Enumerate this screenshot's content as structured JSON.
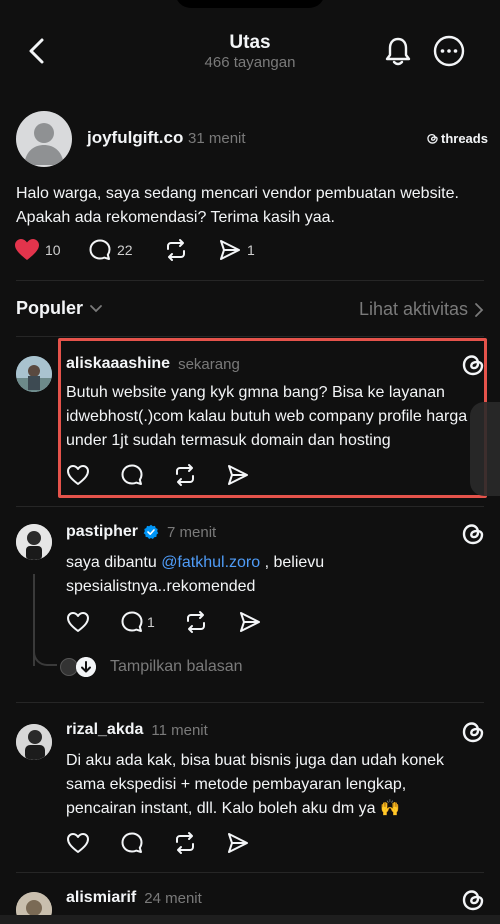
{
  "header": {
    "title": "Utas",
    "views": "466 tayangan"
  },
  "post": {
    "username": "joyfulgift.co",
    "time": "31 menit",
    "brand": "threads",
    "text": "Halo warga, saya sedang mencari vendor pembuatan website. Apakah ada rekomendasi? Terima kasih yaa.",
    "likes": "10",
    "comments": "22",
    "shares": "1",
    "like_color": "#e3344c"
  },
  "sort": {
    "label": "Populer",
    "activity": "Lihat aktivitas"
  },
  "replies": [
    {
      "username": "aliskaaashine",
      "time": "sekarang",
      "text": "Butuh website yang kyk gmna bang? Bisa ke layanan idwebhost(.)com kalau butuh web company profile harga under 1jt sudah termasuk domain dan hosting"
    },
    {
      "username": "pastipher",
      "time": "7 menit",
      "text_prefix": "saya dibantu ",
      "mention": "@fatkhul.zoro",
      "text_suffix": " , believu spesialistnya..rekomended",
      "comments": "1",
      "show_replies": "Tampilkan balasan"
    },
    {
      "username": "rizal_akda",
      "time": "11 menit",
      "text": "Di aku ada kak, bisa buat bisnis juga dan udah konek sama ekspedisi + metode pembayaran lengkap, pencairan instant, dll. Kalo boleh aku dm ya 🙌"
    },
    {
      "username": "alismiarif",
      "time": "24 menit"
    }
  ],
  "colors": {
    "background": "#101010",
    "highlight_border": "#e5534b",
    "mention": "#4f9cf7",
    "verified": "#0095f6"
  }
}
